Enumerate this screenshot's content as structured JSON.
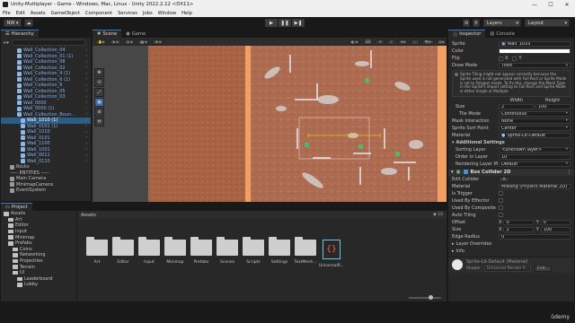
{
  "window": {
    "title": "Unity-Multiplayer - Game - Windows, Mac, Linux - Unity 2022.2.12 <DX11>",
    "controls": [
      "—",
      "☐",
      "✕"
    ]
  },
  "menu": [
    "File",
    "Edit",
    "Assets",
    "GameObject",
    "Component",
    "Services",
    "Jobs",
    "Window",
    "Help"
  ],
  "toolbar": {
    "account": "NW ▾",
    "cloud": "☁",
    "play": "▶",
    "pause": "❚❚",
    "step": "▶❚",
    "layers": "Layers",
    "layout": "Layout"
  },
  "hierarchy": {
    "tab": "Hierarchy",
    "items": [
      {
        "label": "Wall_Collection_04",
        "type": "blue"
      },
      {
        "label": "Wall_Collection_01 (1)",
        "type": "blue"
      },
      {
        "label": "Wall_Collection_08",
        "type": "blue"
      },
      {
        "label": "Wall_Collection_02",
        "type": "blue"
      },
      {
        "label": "Wall_Collection_4 (1)",
        "type": "blue"
      },
      {
        "label": "Wall_Collection_6 (1)",
        "type": "blue"
      },
      {
        "label": "Wall_Collection_6",
        "type": "blue"
      },
      {
        "label": "Wall_Collection_05",
        "type": "blue"
      },
      {
        "label": "Wall_Collection_03",
        "type": "blue"
      },
      {
        "label": "Wall_0000",
        "type": "blue"
      },
      {
        "label": "Wall_0000 (1)",
        "type": "blue"
      },
      {
        "label": "Wall_Collection_Boun...",
        "type": "blue"
      },
      {
        "label": "Wall_1010 (1)",
        "type": "selected"
      },
      {
        "label": "Wall_0101 (1)",
        "type": "blue"
      },
      {
        "label": "Wall_1010",
        "type": "blue"
      },
      {
        "label": "Wall_0101",
        "type": "blue"
      },
      {
        "label": "Wall_1100",
        "type": "blue"
      },
      {
        "label": "Wall_1001",
        "type": "blue"
      },
      {
        "label": "Wall_0011",
        "type": "blue"
      },
      {
        "label": "Wall_0110",
        "type": "blue"
      },
      {
        "label": "Rocks",
        "type": "grey"
      },
      {
        "label": "----- ENTITIES -----",
        "type": "plain"
      },
      {
        "label": "Main Camera",
        "type": "grey"
      },
      {
        "label": "MinimapCamera",
        "type": "grey"
      },
      {
        "label": "EventSystem",
        "type": "grey"
      }
    ]
  },
  "scene": {
    "tabs": [
      "Scene",
      "Game"
    ],
    "tools": [
      "✥",
      "⟲",
      "⤢",
      "▣",
      "⊕",
      "⚒"
    ]
  },
  "inspector": {
    "tabs": [
      "Inspector",
      "Console"
    ],
    "sprite": "Wall_1010",
    "color_label": "Color",
    "flip_label": "Flip",
    "flip_x": "X",
    "flip_y": "Y",
    "draw_mode_label": "Draw Mode",
    "draw_mode": "Tiled",
    "tiling_warning": "Sprite Tiling might not appear correctly because the Sprite used is not generated with Full Rect or Sprite Mode is set to Polygon mode. To fix this, change the Mesh Type in the Sprite's import setting to Full Rect and Sprite Mode is either Single or Multiple",
    "size_label": "Size",
    "width_label": "Width",
    "height_label": "Height",
    "width": "2",
    "height": "100",
    "tile_mode_label": "Tile Mode",
    "tile_mode": "Continuous",
    "mask_label": "Mask Interaction",
    "mask": "None",
    "sort_point_label": "Sprite Sort Point",
    "sort_point": "Center",
    "material_label": "Material",
    "material": "Sprite-Lit-Default",
    "additional_label": "Additional Settings",
    "sorting_layer_label": "Sorting Layer",
    "sorting_layer": "<unknown layer>",
    "order_label": "Order in Layer",
    "order": "10",
    "rendering_layer_label": "Rendering Layer M",
    "rendering_layer": "Default",
    "box_collider_title": "Box Collider 2D",
    "edit_collider_label": "Edit Collider",
    "bc_material_label": "Material",
    "bc_material": "Missing (Physics Material 2D)",
    "is_trigger_label": "Is Trigger",
    "used_effector_label": "Used By Effector",
    "used_composite_label": "Used By Composite",
    "auto_tiling_label": "Auto Tiling",
    "offset_label": "Offset",
    "offset_x": "0",
    "offset_y": "0",
    "bc_size_label": "Size",
    "bc_size_x": "2",
    "bc_size_y": "100",
    "edge_radius_label": "Edge Radius",
    "edge_radius": "0",
    "layer_overrides_label": "Layer Overrides",
    "info_label": "Info",
    "material_asset": "Sprite-Lit-Default (Material)",
    "shader_label": "Shader",
    "shader": "Universal Render P...",
    "edit_label": "Edit..."
  },
  "project": {
    "tabs": [
      "Project"
    ],
    "tree": [
      {
        "label": "Assets",
        "indent": 0
      },
      {
        "label": "Art",
        "indent": 1
      },
      {
        "label": "Editor",
        "indent": 1
      },
      {
        "label": "Input",
        "indent": 1
      },
      {
        "label": "Minimap",
        "indent": 1
      },
      {
        "label": "Prefabs",
        "indent": 1
      },
      {
        "label": "Coins",
        "indent": 2
      },
      {
        "label": "Networking",
        "indent": 2
      },
      {
        "label": "Projectiles",
        "indent": 2
      },
      {
        "label": "Terrain",
        "indent": 2
      },
      {
        "label": "UI",
        "indent": 2
      },
      {
        "label": "Leaderboard",
        "indent": 3
      },
      {
        "label": "Lobby",
        "indent": 3
      }
    ],
    "breadcrumb": "Assets",
    "asset_count": "10",
    "assets": [
      "Art",
      "Editor",
      "Input",
      "Minimap",
      "Prefabs",
      "Scenes",
      "Scripts",
      "Settings",
      "TextMesh...",
      "UniversalR..."
    ]
  },
  "watermark": "ûdemy",
  "colors": {
    "accent": "#3a79bb",
    "selected": "#2c5d87",
    "stripe": "#f2a062"
  }
}
